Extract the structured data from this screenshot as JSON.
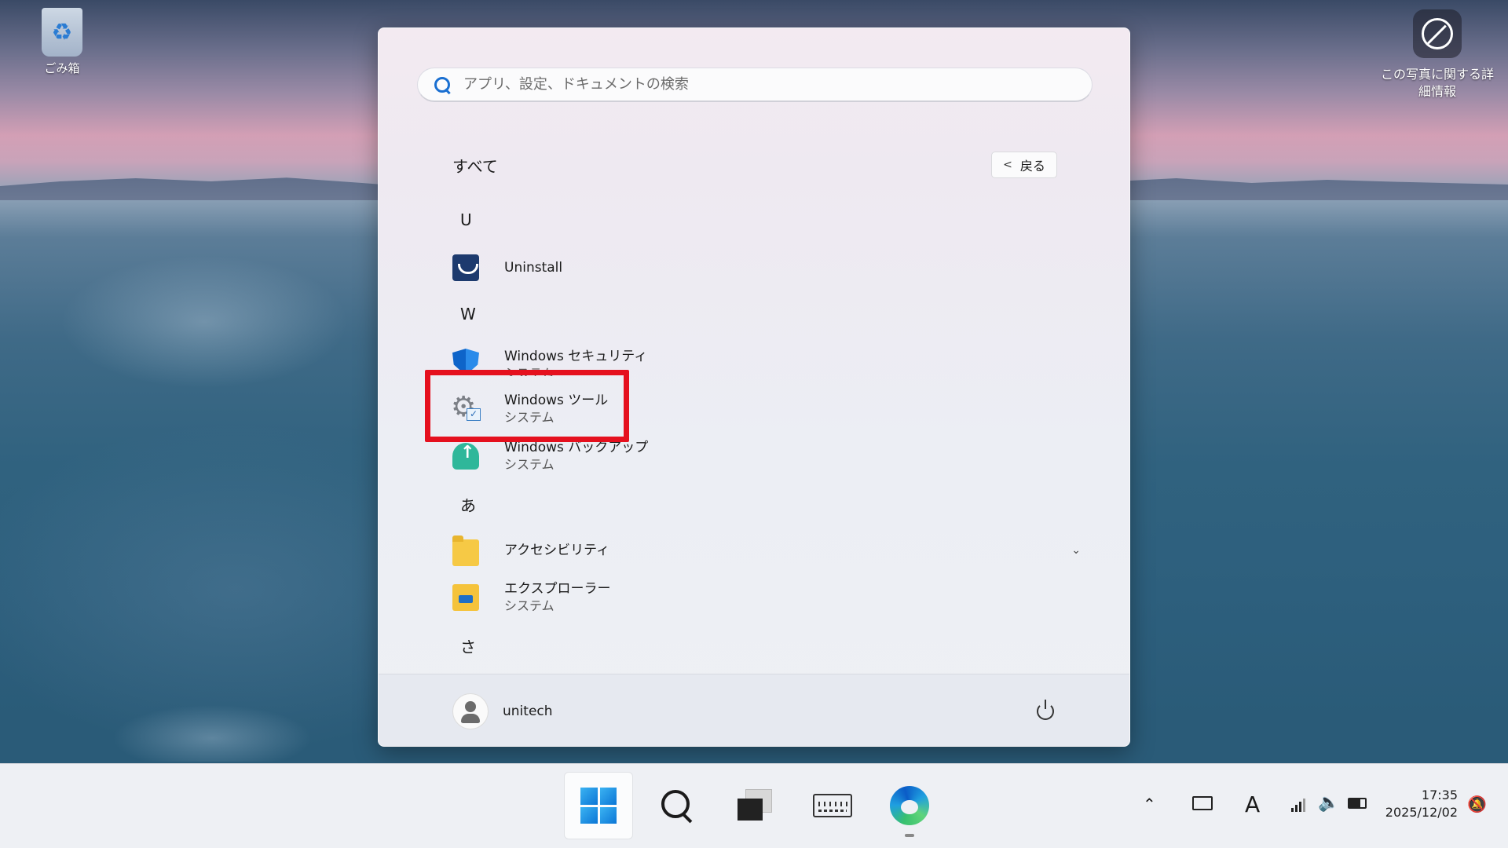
{
  "desktop": {
    "recycle_bin_label": "ごみ箱",
    "photo_info_label_line1": "この写真に関する詳",
    "photo_info_label_line2": "細情報"
  },
  "start_menu": {
    "search": {
      "placeholder": "アプリ、設定、ドキュメントの検索",
      "icon": "search-icon"
    },
    "section_title": "すべて",
    "back_button": {
      "label": "戻る",
      "icon": "chevron-left-icon"
    },
    "groups": [
      {
        "letter": "U",
        "apps": [
          {
            "name": "Uninstall",
            "subtitle": "",
            "icon": "uninstall-icon"
          }
        ]
      },
      {
        "letter": "W",
        "apps": [
          {
            "name": "Windows セキュリティ",
            "subtitle": "システム",
            "icon": "shield-icon"
          },
          {
            "name": "Windows ツール",
            "subtitle": "システム",
            "icon": "gear-check-icon"
          },
          {
            "name": "Windows バックアップ",
            "subtitle": "システム",
            "icon": "cloud-upload-icon"
          }
        ]
      },
      {
        "letter": "あ",
        "apps": [
          {
            "name": "アクセシビリティ",
            "subtitle": "",
            "icon": "folder-icon",
            "expandable": true
          },
          {
            "name": "エクスプローラー",
            "subtitle": "システム",
            "icon": "file-explorer-icon"
          }
        ]
      },
      {
        "letter": "さ",
        "apps": []
      }
    ],
    "highlight_color": "#e5101e",
    "footer": {
      "user_name": "unitech",
      "power_icon": "power-icon"
    }
  },
  "taskbar": {
    "items": [
      "start-button",
      "search-button",
      "task-view-button",
      "touch-keyboard-button",
      "edge-button"
    ],
    "tray": {
      "ime_mode": "A",
      "time": "17:35",
      "date": "2025/12/02"
    }
  }
}
